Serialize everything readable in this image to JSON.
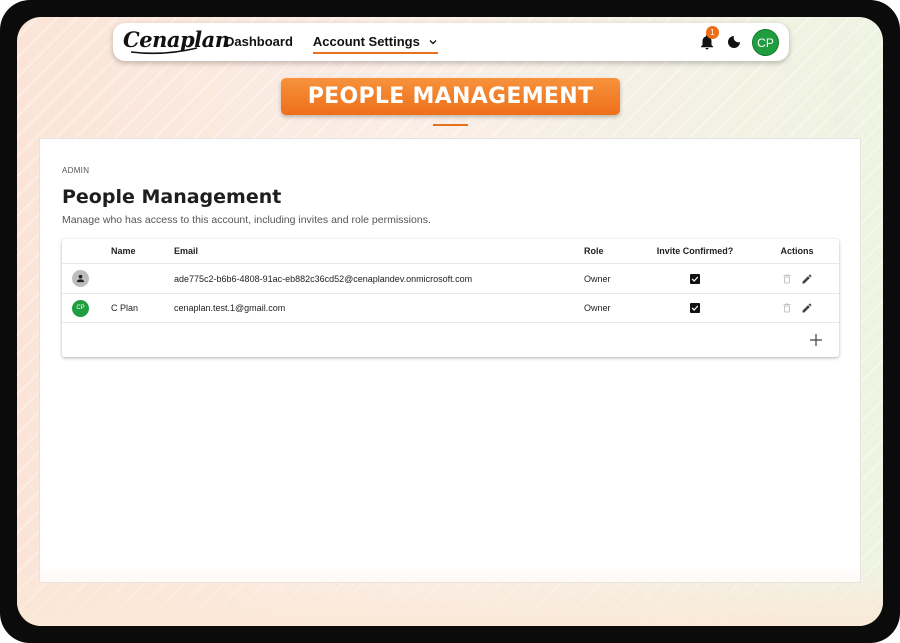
{
  "app": {
    "logo_text": "Cenaplan"
  },
  "nav": {
    "dashboard": "Dashboard",
    "account_settings": "Account Settings",
    "notification_count": "1",
    "user_initials": "CP"
  },
  "banner": {
    "text": "PEOPLE MANAGEMENT"
  },
  "page": {
    "breadcrumb": "ADMIN",
    "title": "People Management",
    "subtitle": "Manage who has access to this account, including invites and role permissions."
  },
  "table": {
    "columns": {
      "name": "Name",
      "email": "Email",
      "role": "Role",
      "invite_confirmed": "Invite Confirmed?",
      "actions": "Actions"
    },
    "rows": [
      {
        "avatar": "person-icon",
        "name": "",
        "email": "ade775c2-b6b6-4808-91ac-eb882c36cd52@cenaplandev.onmicrosoft.com",
        "role": "Owner",
        "invite_confirmed": true
      },
      {
        "avatar": "CP",
        "name": "C Plan",
        "email": "cenaplan.test.1@gmail.com",
        "role": "Owner",
        "invite_confirmed": true
      }
    ]
  },
  "colors": {
    "accent": "#ee6f1a",
    "avatar_green": "#1f9d3f",
    "badge": "#ef6c16"
  }
}
